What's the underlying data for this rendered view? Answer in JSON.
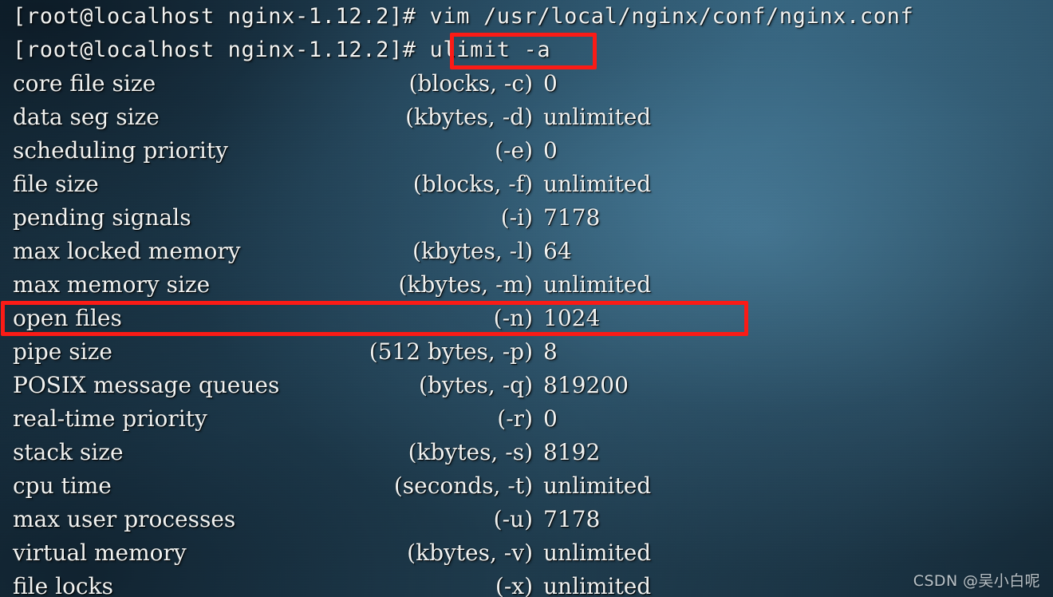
{
  "window": {
    "title": "Terminal - ulimit -a",
    "background_color": "#2e5c77",
    "text_color": "#f2f4f3",
    "highlight_color": "#fb1b16"
  },
  "prompt_lines": [
    {
      "text": "[root@localhost nginx-1.12.2]# vim /usr/local/nginx/conf/nginx.conf"
    },
    {
      "text": "[root@localhost nginx-1.12.2]# ulimit -a"
    }
  ],
  "command": {
    "user": "root",
    "host": "localhost",
    "cwd": "nginx-1.12.2",
    "symbol": "#",
    "previous_command": "vim /usr/local/nginx/conf/nginx.conf",
    "current_command": "ulimit -a"
  },
  "limits": [
    {
      "label": "core file size",
      "unit": "(blocks, -c)",
      "value": "0"
    },
    {
      "label": "data seg size",
      "unit": "(kbytes, -d)",
      "value": "unlimited"
    },
    {
      "label": "scheduling priority",
      "unit": "(-e)",
      "value": "0"
    },
    {
      "label": "file size",
      "unit": "(blocks, -f)",
      "value": "unlimited"
    },
    {
      "label": "pending signals",
      "unit": "(-i)",
      "value": "7178"
    },
    {
      "label": "max locked memory",
      "unit": "(kbytes, -l)",
      "value": "64"
    },
    {
      "label": "max memory size",
      "unit": "(kbytes, -m)",
      "value": "unlimited"
    },
    {
      "label": "open files",
      "unit": "(-n)",
      "value": "1024"
    },
    {
      "label": "pipe size",
      "unit": "(512 bytes, -p)",
      "value": "8"
    },
    {
      "label": "POSIX message queues",
      "unit": "(bytes, -q)",
      "value": "819200"
    },
    {
      "label": "real-time priority",
      "unit": "(-r)",
      "value": "0"
    },
    {
      "label": "stack size",
      "unit": "(kbytes, -s)",
      "value": "8192"
    },
    {
      "label": "cpu time",
      "unit": "(seconds, -t)",
      "value": "unlimited"
    },
    {
      "label": "max user processes",
      "unit": "(-u)",
      "value": "7178"
    },
    {
      "label": "virtual memory",
      "unit": "(kbytes, -v)",
      "value": "unlimited"
    },
    {
      "label": "file locks",
      "unit": "(-x)",
      "value": "unlimited"
    }
  ],
  "highlights": [
    {
      "name": "ulimit-command",
      "target": "ulimit -a"
    },
    {
      "name": "open-files-row",
      "target": "open files (-n) 1024"
    }
  ],
  "watermark": {
    "text": "CSDN @吴小白呢"
  }
}
